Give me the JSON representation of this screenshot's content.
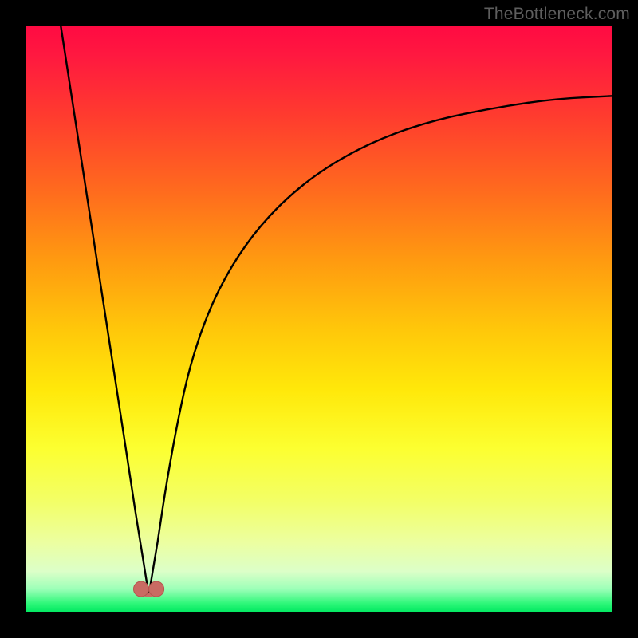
{
  "watermark": "TheBottleneck.com",
  "colors": {
    "frame": "#000000",
    "curve": "#000000",
    "marker_fill": "#c96b63",
    "marker_stroke": "#b6554e"
  },
  "chart_data": {
    "type": "line",
    "title": "",
    "xlabel": "",
    "ylabel": "",
    "xlim": [
      0,
      100
    ],
    "ylim": [
      0,
      100
    ],
    "grid": false,
    "legend": false,
    "series": [
      {
        "name": "bottleneck-curve",
        "note": "y = 100 at top, ~2 at bottom; curve is roughly V-shaped with minimum near x≈21 and a concave right branch approaching y≈88 at x=100",
        "x": [
          6,
          8,
          10,
          12,
          14,
          16,
          18,
          19.5,
          21,
          22.5,
          24,
          26,
          28,
          31,
          35,
          40,
          46,
          53,
          61,
          70,
          80,
          90,
          100
        ],
        "y": [
          100,
          87,
          74,
          61,
          48,
          35,
          22,
          12,
          3,
          12,
          22,
          33,
          42,
          51,
          59,
          66,
          72,
          77,
          81,
          84,
          86,
          87.5,
          88
        ]
      }
    ],
    "markers": [
      {
        "name": "min-left",
        "x": 19.7,
        "y": 4.0
      },
      {
        "name": "min-right",
        "x": 22.3,
        "y": 4.0
      }
    ],
    "min_connector": {
      "from": 0,
      "to": 1,
      "depth_y": 2.0
    }
  }
}
